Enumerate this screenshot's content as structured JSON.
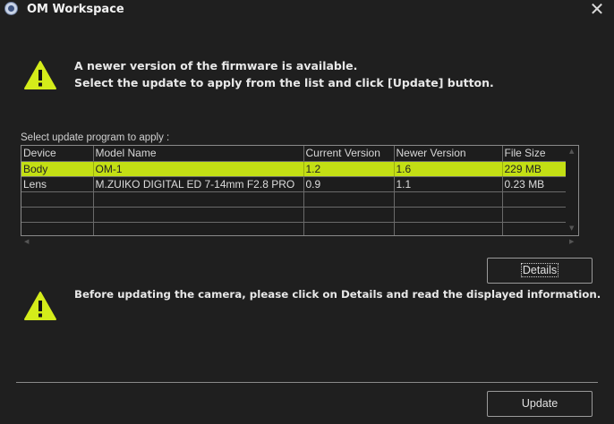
{
  "window": {
    "title": "OM Workspace",
    "close_glyph": "✕"
  },
  "notice": {
    "line1": "A newer version of the firmware is available.",
    "line2": "Select the update to apply from the list and click [Update] button."
  },
  "list": {
    "caption": "Select update program to apply :",
    "columns": [
      "Device",
      "Model Name",
      "Current Version",
      "Newer Version",
      "File Size"
    ],
    "rows": [
      {
        "device": "Body",
        "model": "OM-1",
        "current": "1.2",
        "newer": "1.6",
        "size": "229 MB",
        "selected": true
      },
      {
        "device": "Lens",
        "model": "M.ZUIKO DIGITAL ED 7-14mm F2.8 PRO",
        "current": "0.9",
        "newer": "1.1",
        "size": "0.23 MB",
        "selected": false
      }
    ],
    "selected_color": "#c3df14"
  },
  "details_button": {
    "label": "Details"
  },
  "warning": {
    "text": "Before updating the camera, please click on Details and read the displayed information."
  },
  "update_button": {
    "label": "Update"
  },
  "icons": {
    "app": "om-workspace-logo-icon",
    "warning": "warning-triangle-icon",
    "close": "close-icon"
  }
}
